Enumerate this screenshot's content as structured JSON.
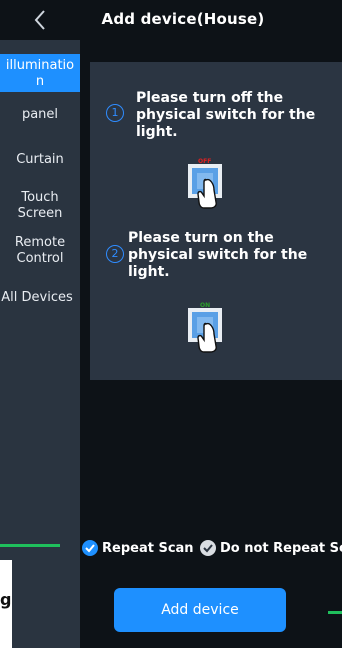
{
  "header": {
    "title": "Add device(House)"
  },
  "sidebar": {
    "items": [
      {
        "label": "illuminatio\nn"
      },
      {
        "label": "panel"
      },
      {
        "label": "Curtain"
      },
      {
        "label": "Touch\nScreen"
      },
      {
        "label": "Remote\nControl"
      },
      {
        "label": "All Devices"
      }
    ]
  },
  "instructions": {
    "step1": {
      "number": "1",
      "text": "Please turn off the physical switch for the light.",
      "switch_label": "OFF"
    },
    "step2": {
      "number": "2",
      "text": "Please turn on the physical switch for the light.",
      "switch_label": "ON"
    }
  },
  "scan_options": {
    "repeat": {
      "label": "Repeat Scan",
      "checked": true
    },
    "no_repeat": {
      "label": "Do not Repeat Scan",
      "checked": true
    }
  },
  "actions": {
    "add_device_label": "Add device"
  },
  "overlay_text": "g",
  "colors": {
    "accent": "#1e90ff",
    "background": "#0d1217",
    "sidebar": "#2a3440",
    "panel": "#2b3542",
    "annotation_green": "#1fbf5c"
  }
}
